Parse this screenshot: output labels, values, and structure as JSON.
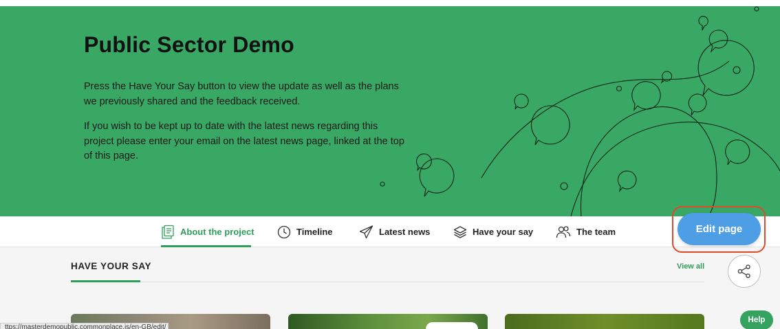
{
  "hero": {
    "title": "Public Sector Demo",
    "paragraph_1": "Press the Have Your Say button to view the update as well as the plans we previously shared and the feedback received.",
    "paragraph_2": "If you wish to be kept up to date with the latest news regarding this project please enter your email on the latest news page, linked at the top of this page.",
    "background_color": "#38a864"
  },
  "nav": {
    "items": [
      {
        "label": "About the project",
        "icon": "document-icon",
        "active": true
      },
      {
        "label": "Timeline",
        "icon": "clock-icon",
        "active": false
      },
      {
        "label": "Latest news",
        "icon": "paper-plane-icon",
        "active": false
      },
      {
        "label": "Have your say",
        "icon": "layers-icon",
        "active": false
      },
      {
        "label": "The team",
        "icon": "people-icon",
        "active": false
      }
    ],
    "active_color": "#2f9d5a"
  },
  "edit_button": {
    "label": "Edit page",
    "color": "#4e9ee6",
    "highlight_color": "#e0492a"
  },
  "share_button": {
    "icon": "share-icon"
  },
  "section": {
    "title": "HAVE YOUR SAY",
    "view_all": "View all"
  },
  "status_bar": {
    "url": "ttps://masterdemopublic.commonplace.is/en-GB/edit/"
  },
  "help_button": {
    "label": "Help"
  }
}
